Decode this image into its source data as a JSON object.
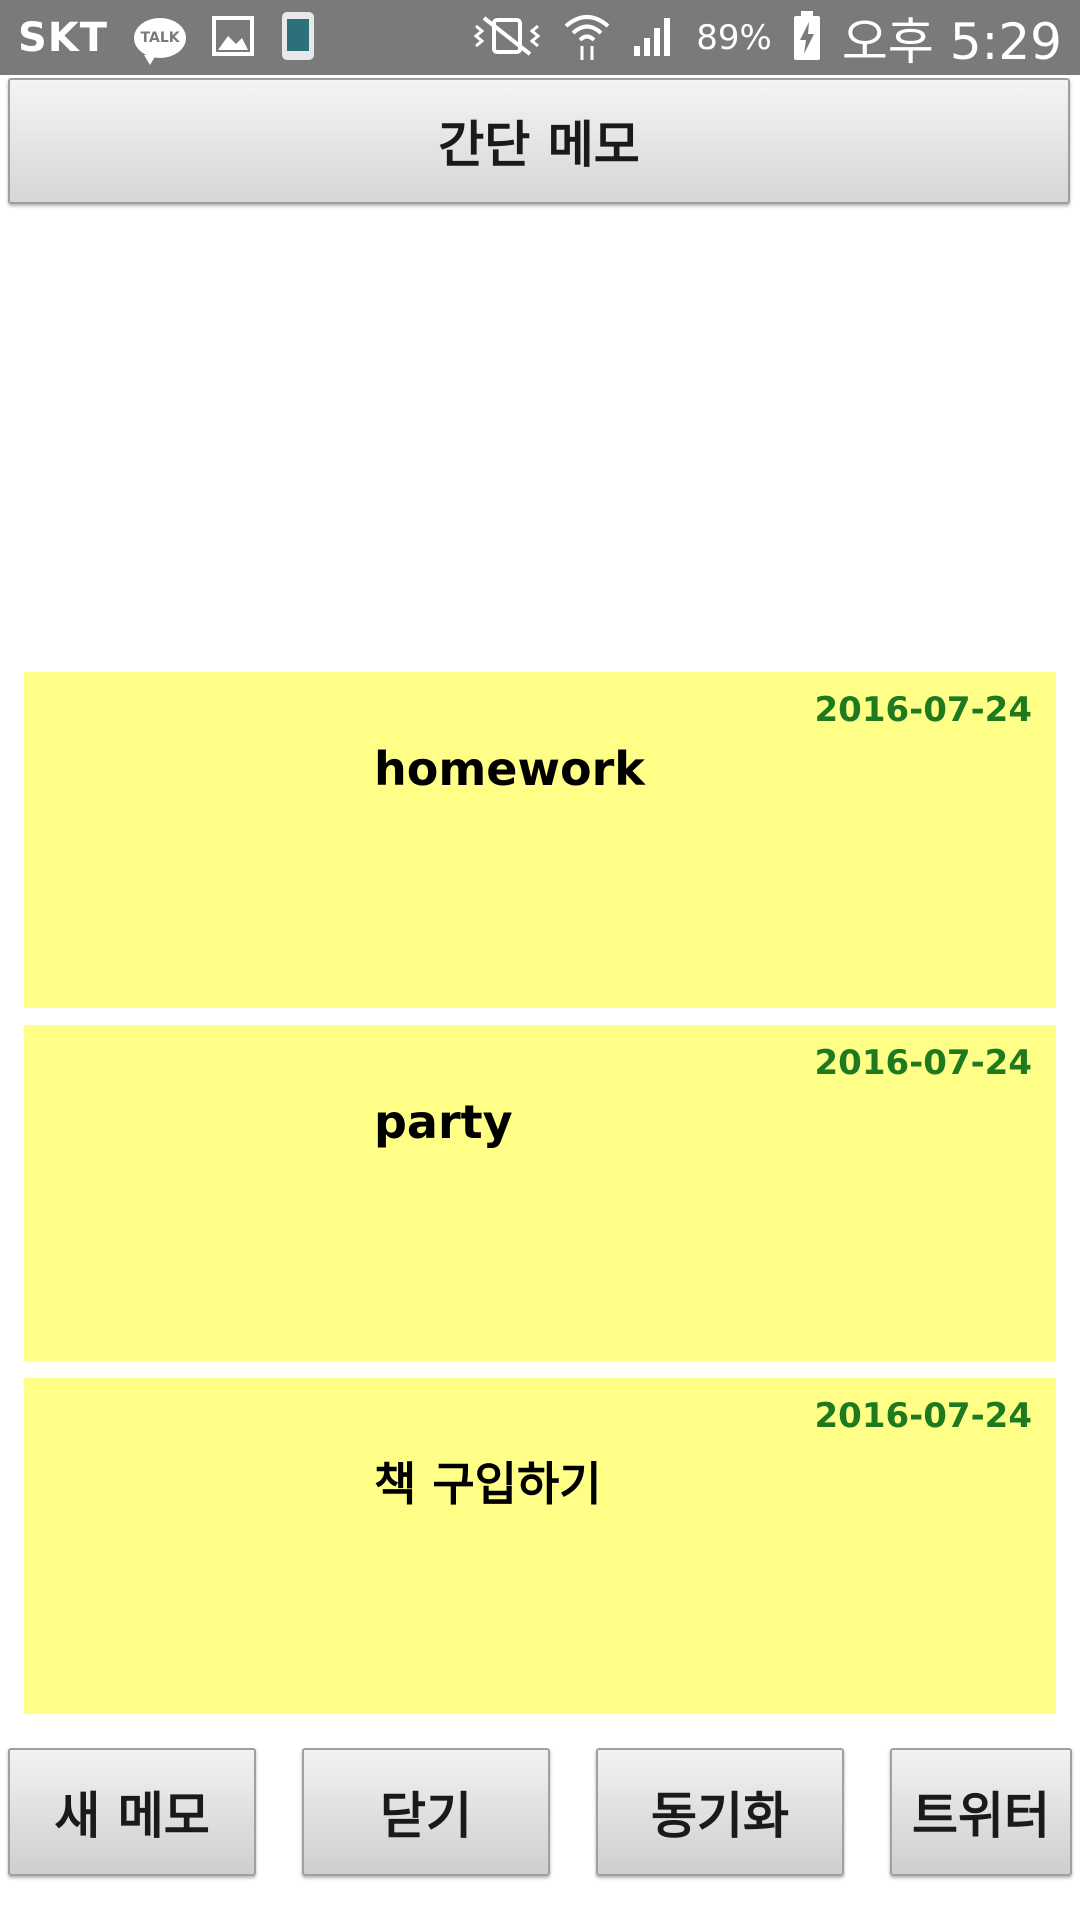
{
  "status_bar": {
    "carrier": "SKT",
    "talk_label": "TALK",
    "icons": [
      "kakaotalk-icon",
      "gallery-icon",
      "phone-icon",
      "vibrate-mute-icon",
      "wifi-icon",
      "signal-icon",
      "battery-charging-icon"
    ],
    "battery": "89%",
    "time": "오후 5:29"
  },
  "header": {
    "title": "간단 메모"
  },
  "memos": [
    {
      "title": "homework",
      "date": "2016-07-24"
    },
    {
      "title": "party",
      "date": "2016-07-24"
    },
    {
      "title": "책 구입하기",
      "date": "2016-07-24"
    }
  ],
  "buttons": {
    "new_memo": "새 메모",
    "close": "닫기",
    "sync": "동기화",
    "twitter": "트위터"
  },
  "colors": {
    "memo_background": "#ffff88",
    "date_text": "#1e7a1e",
    "status_bar": "#7a7a7a"
  }
}
